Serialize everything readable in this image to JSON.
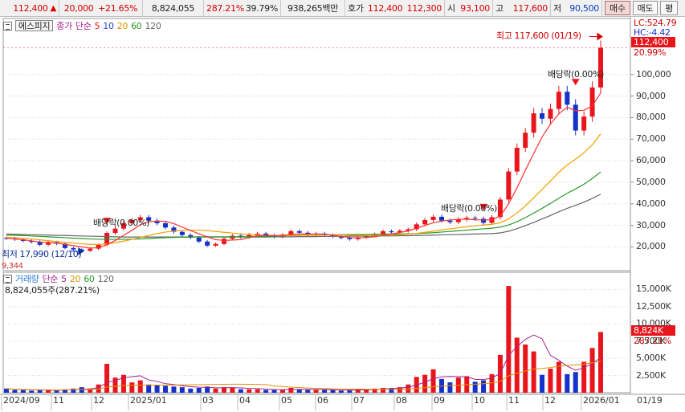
{
  "quote_bar": {
    "price": "112,400",
    "change": "20,000",
    "change_pct": "+21.65%",
    "volume": "8,824,055",
    "volume_ratio": "287.21%",
    "turnover": "39.79%",
    "amount": "938,265백만",
    "ask_label": "호가",
    "ask_price": "112,400",
    "bid_price": "112,300",
    "open_label": "시",
    "open": "93,100",
    "high_label": "고",
    "high": "117,600",
    "low_label": "저",
    "low": "90,500",
    "buy_btn": "매수",
    "sell_btn": "매도",
    "flat_btn": "평"
  },
  "price_legend": {
    "index": "에스피지",
    "price_type": "종가",
    "ma_type": "단순",
    "ma": [
      "5",
      "10",
      "20",
      "60",
      "120"
    ]
  },
  "volume_legend": {
    "label": "거래량",
    "ma_type": "단순",
    "ma": [
      "5",
      "20",
      "60",
      "120"
    ],
    "value": "8,824,055주(287.21%)"
  },
  "annotations": {
    "high_label": "최고 117,600 (01/19)",
    "low_label": "최저 17,990 (12/10)",
    "dividend_1": "배당락(0.00%)",
    "dividend_2": "배당락(0.00%)",
    "dividend_3": "배당락(0.00%)",
    "lc": "LC:524.79",
    "hc": "HC:-4.42",
    "last_price": "112,400",
    "last_pct": "20.99%",
    "bottom_cut": "9,344",
    "vol_last": "8,824K",
    "vol_pct": "287.21%"
  },
  "colors": {
    "up": "#e8161c",
    "down": "#1531c8",
    "ma5": "#ff3333",
    "ma10": "#2244cc",
    "ma20": "#f0a000",
    "ma60": "#2a9a2a",
    "ma120": "#666666"
  },
  "chart_data": {
    "type": "candlestick",
    "price_axis": {
      "ticks": [
        "20,000",
        "30,000",
        "40,000",
        "50,000",
        "60,000",
        "70,000",
        "80,000",
        "90,000",
        "100,000"
      ],
      "range": [
        9000,
        126000
      ]
    },
    "volume_axis": {
      "ticks": [
        "2,500K",
        "5,000K",
        "7,500K",
        "10,000K",
        "12,500K",
        "15,000K"
      ],
      "range": [
        0,
        17500
      ]
    },
    "x_ticks": [
      "2024/09",
      "11",
      "12",
      "2025/01",
      "03",
      "04",
      "05",
      "06",
      "07",
      "08",
      "09",
      "10",
      "11",
      "12",
      "2026/01",
      "01/19"
    ],
    "price_series": [
      [
        24000,
        0.6
      ],
      [
        23500,
        0.4
      ],
      [
        22800,
        0.4
      ],
      [
        22300,
        0.3
      ],
      [
        21000,
        0.4
      ],
      [
        22200,
        0.4
      ],
      [
        21500,
        0.3
      ],
      [
        19500,
        0.5
      ],
      [
        18800,
        0.6
      ],
      [
        18200,
        0.8
      ],
      [
        19200,
        0.6
      ],
      [
        21000,
        1.2
      ],
      [
        26500,
        4.2
      ],
      [
        28500,
        2.2
      ],
      [
        31000,
        2.6
      ],
      [
        32500,
        1.5
      ],
      [
        33800,
        1.8
      ],
      [
        32200,
        1.2
      ],
      [
        31000,
        1.1
      ],
      [
        29000,
        1.0
      ],
      [
        27000,
        0.9
      ],
      [
        25500,
        0.8
      ],
      [
        24300,
        0.6
      ],
      [
        22500,
        0.7
      ],
      [
        20600,
        0.9
      ],
      [
        21400,
        0.6
      ],
      [
        23800,
        0.8
      ],
      [
        25200,
        0.7
      ],
      [
        24600,
        0.5
      ],
      [
        25800,
        0.5
      ],
      [
        26200,
        0.5
      ],
      [
        25300,
        0.4
      ],
      [
        24800,
        0.4
      ],
      [
        25700,
        0.4
      ],
      [
        27300,
        0.7
      ],
      [
        26600,
        0.5
      ],
      [
        25800,
        0.4
      ],
      [
        26200,
        0.4
      ],
      [
        25400,
        0.4
      ],
      [
        24800,
        0.4
      ],
      [
        24200,
        0.3
      ],
      [
        23600,
        0.4
      ],
      [
        24500,
        0.5
      ],
      [
        25200,
        0.5
      ],
      [
        25900,
        0.6
      ],
      [
        27300,
        0.7
      ],
      [
        26800,
        0.7
      ],
      [
        27500,
        0.8
      ],
      [
        28200,
        1.2
      ],
      [
        30500,
        2.3
      ],
      [
        32500,
        2.6
      ],
      [
        34000,
        3.4
      ],
      [
        32200,
        2.0
      ],
      [
        31500,
        1.5
      ],
      [
        32800,
        2.2
      ],
      [
        33500,
        2.4
      ],
      [
        33100,
        1.6
      ],
      [
        31200,
        1.8
      ],
      [
        33800,
        2.7
      ],
      [
        42000,
        5.5
      ],
      [
        55000,
        15.5
      ],
      [
        66000,
        8.0
      ],
      [
        73000,
        7.0
      ],
      [
        82000,
        6.0
      ],
      [
        79500,
        2.6
      ],
      [
        84000,
        3.5
      ],
      [
        92000,
        4.5
      ],
      [
        86000,
        2.7
      ],
      [
        74000,
        3.0
      ],
      [
        80500,
        4.5
      ],
      [
        94000,
        6.5
      ],
      [
        112400,
        8.82
      ]
    ],
    "ma5": [
      24000,
      23700,
      23300,
      22800,
      22300,
      22100,
      21800,
      21200,
      20600,
      20000,
      19500,
      19600,
      21000,
      23000,
      25400,
      27700,
      30300,
      31700,
      32000,
      31900,
      30800,
      29200,
      27600,
      26100,
      24700,
      23400,
      23000,
      23200,
      23400,
      24300,
      25200,
      25400,
      25300,
      25400,
      25800,
      26000,
      26000,
      26000,
      25900,
      25400,
      24900,
      24400,
      24200,
      24400,
      24700,
      25400,
      26000,
      26700,
      27400,
      28700,
      30000,
      31200,
      32000,
      32500,
      32800,
      32900,
      32600,
      32500,
      32700,
      34300,
      40000,
      47400,
      55600,
      63400,
      71000,
      77000,
      81800,
      84800,
      83200,
      83400,
      85400,
      91500
    ],
    "ma20": [
      24500,
      24300,
      24000,
      23700,
      23300,
      22900,
      22500,
      22100,
      21800,
      21500,
      21200,
      21100,
      21400,
      22000,
      22700,
      23500,
      24400,
      25300,
      26200,
      26900,
      27400,
      27700,
      27800,
      27800,
      27600,
      27200,
      26800,
      26400,
      26000,
      25700,
      25500,
      25400,
      25300,
      25300,
      25300,
      25400,
      25500,
      25600,
      25700,
      25700,
      25600,
      25500,
      25400,
      25300,
      25300,
      25400,
      25500,
      25700,
      25900,
      26300,
      26800,
      27300,
      27900,
      28400,
      28900,
      29400,
      29800,
      30200,
      30500,
      31200,
      33000,
      35800,
      39000,
      42800,
      46700,
      50600,
      54600,
      58000,
      60700,
      63700,
      67400,
      72500
    ],
    "ma60": [
      25500,
      25400,
      25300,
      25100,
      24900,
      24700,
      24500,
      24300,
      24100,
      23900,
      23700,
      23600,
      23500,
      23500,
      23500,
      23600,
      23700,
      23900,
      24100,
      24300,
      24400,
      24500,
      24600,
      24700,
      24700,
      24700,
      24700,
      24700,
      24700,
      24800,
      24900,
      25000,
      25100,
      25200,
      25300,
      25400,
      25500,
      25500,
      25600,
      25700,
      25700,
      25800,
      25800,
      25800,
      25900,
      25900,
      26000,
      26000,
      26100,
      26200,
      26400,
      26600,
      26900,
      27200,
      27500,
      27800,
      28100,
      28400,
      28700,
      29200,
      30200,
      31700,
      33600,
      35700,
      37900,
      40200,
      42600,
      44900,
      46900,
      49100,
      51700,
      54800
    ],
    "ma120": [
      26000,
      25900,
      25800,
      25700,
      25600,
      25500,
      25400,
      25300,
      25200,
      25100,
      25000,
      24900,
      24800,
      24700,
      24600,
      24600,
      24600,
      24600,
      24600,
      24600,
      24600,
      24600,
      24600,
      24600,
      24600,
      24600,
      24600,
      24600,
      24600,
      24600,
      24600,
      24600,
      24700,
      24700,
      24700,
      24800,
      24800,
      24800,
      24900,
      24900,
      24900,
      25000,
      25000,
      25000,
      25100,
      25100,
      25100,
      25200,
      25200,
      25300,
      25400,
      25500,
      25600,
      25700,
      25800,
      25900,
      26000,
      26100,
      26200,
      26500,
      27300,
      28500,
      29900,
      31400,
      33000,
      34600,
      36300,
      37900,
      39300,
      40800,
      42500,
      44500
    ]
  }
}
